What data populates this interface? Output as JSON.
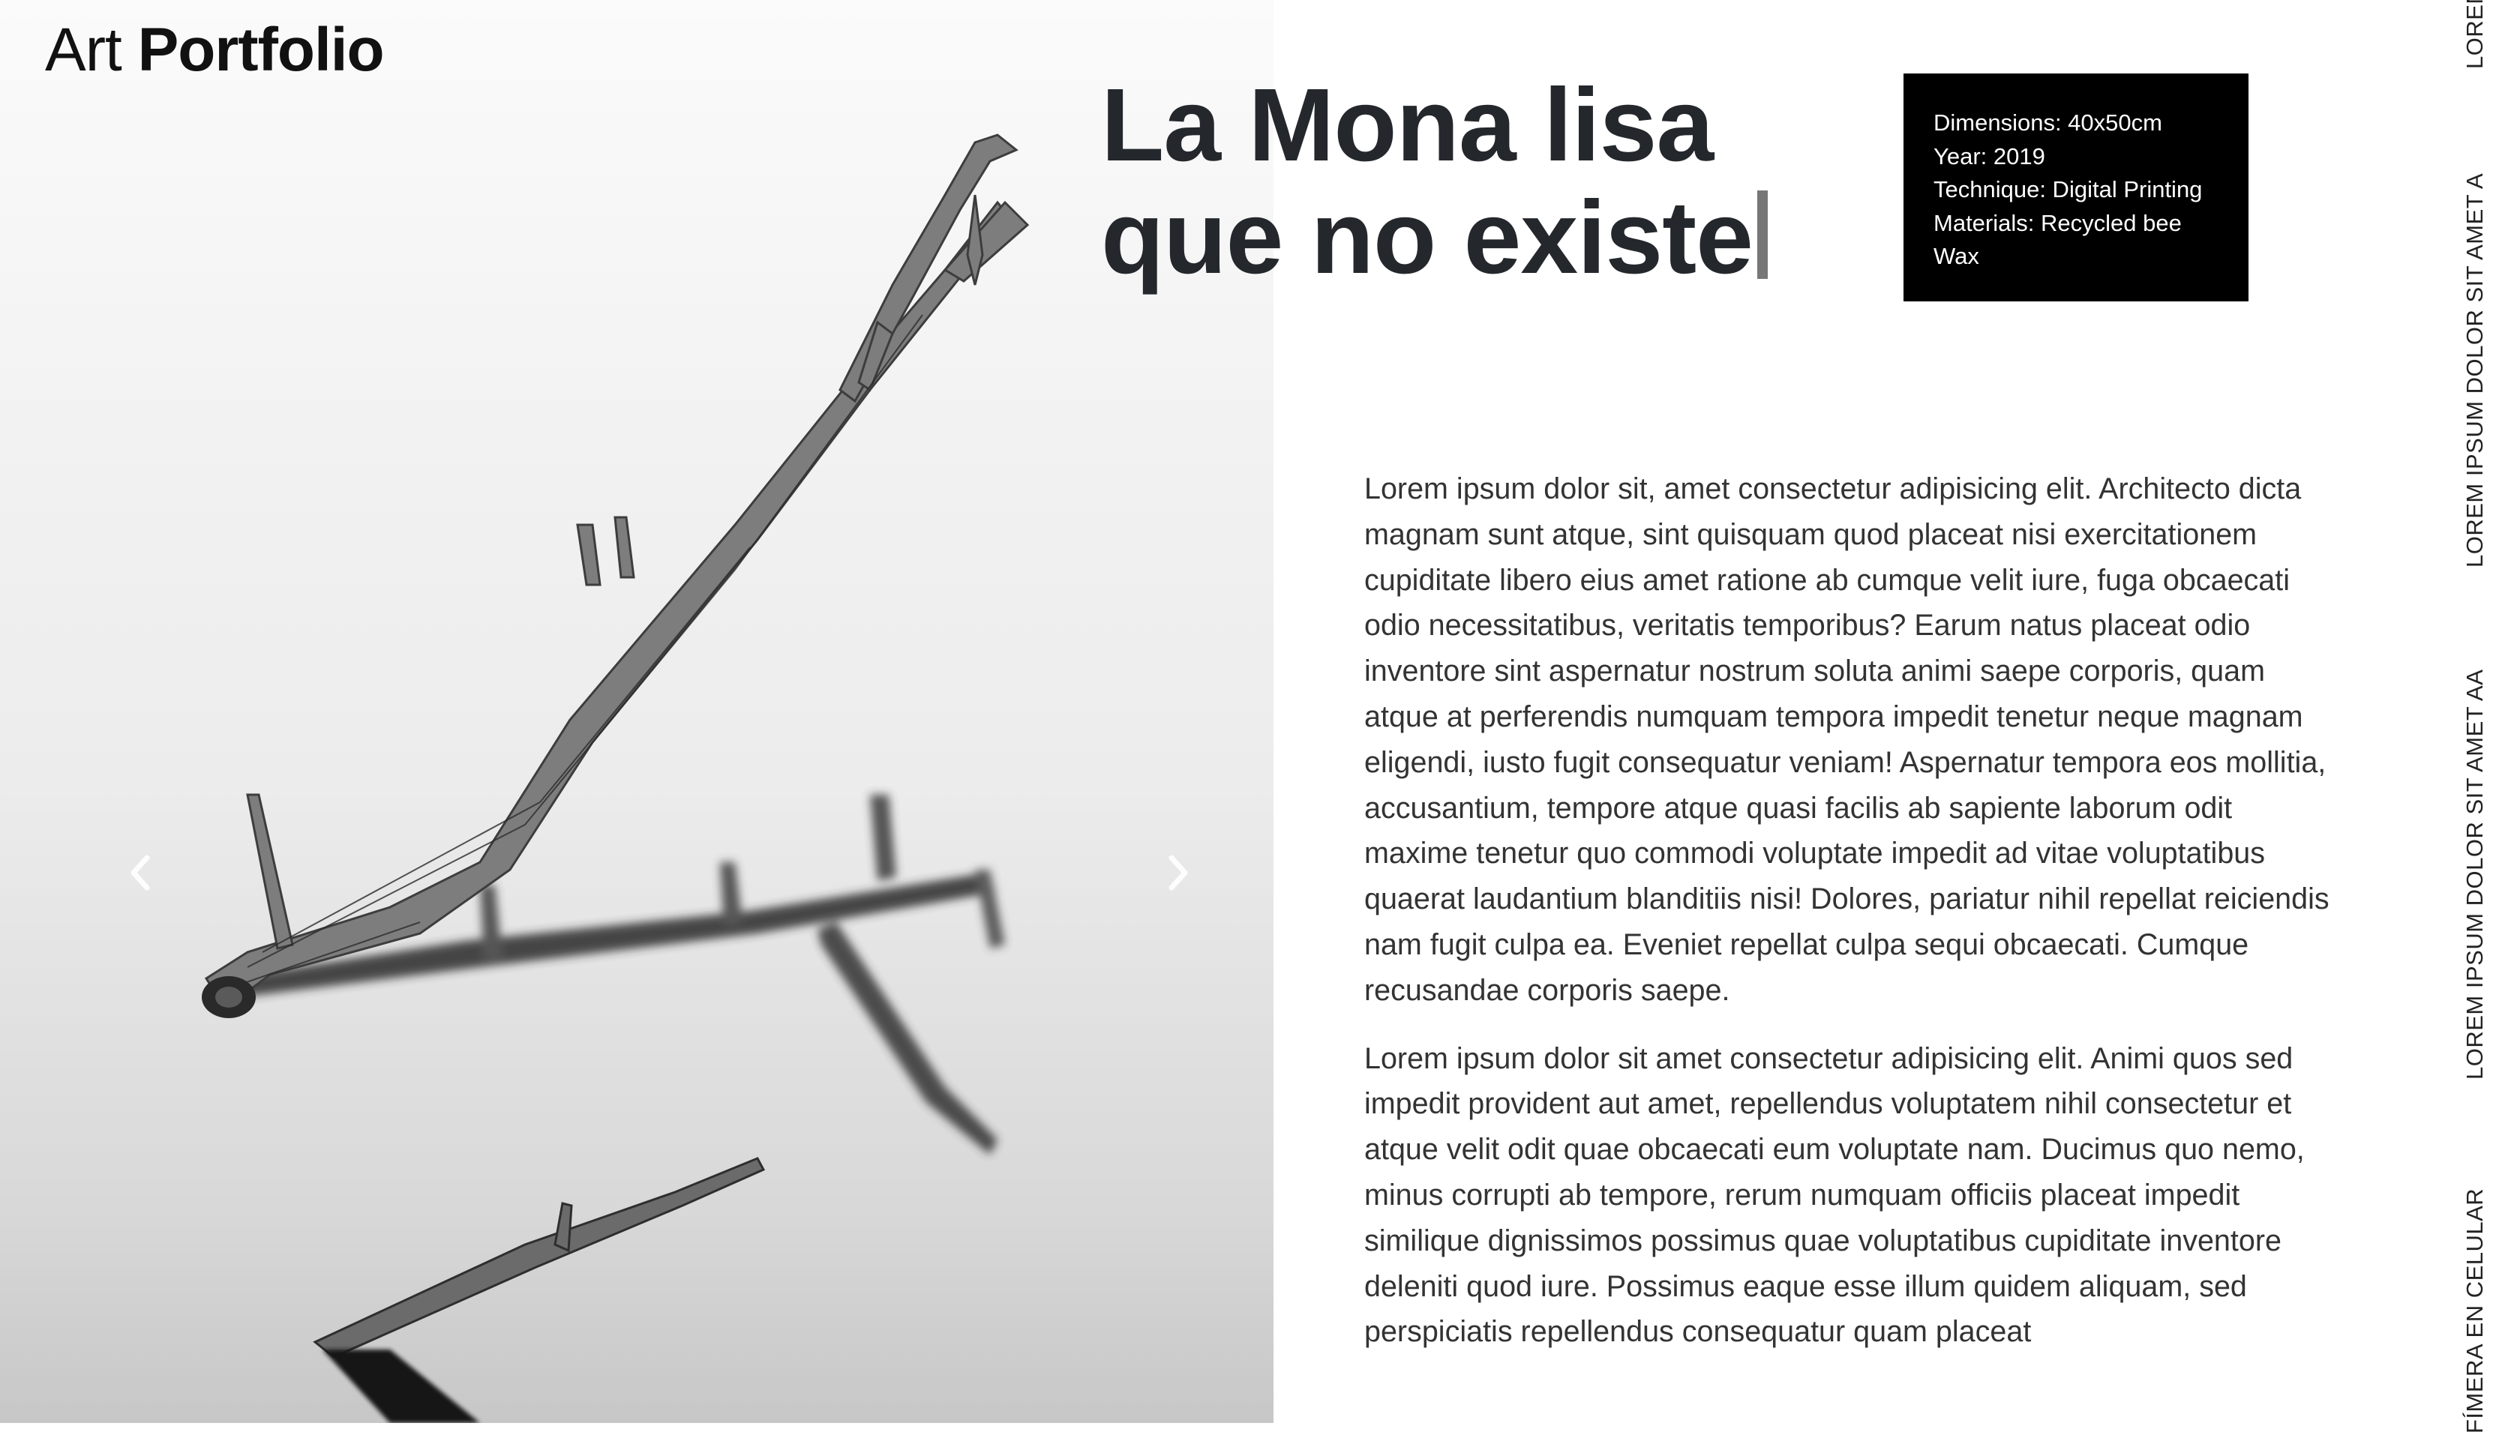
{
  "brand": {
    "light": "Art",
    "bold": "Portfolio"
  },
  "hero": {
    "prev_icon": "chevron-left-icon",
    "next_icon": "chevron-right-icon"
  },
  "artwork": {
    "title": "La Mona lisa que no existe",
    "specs": [
      "Dimensions: 40x50cm",
      "Year: 2019",
      "Technique: Digital Printing",
      "Materials: Recycled bee",
      "Wax"
    ],
    "paragraphs": [
      "Lorem ipsum dolor sit, amet consectetur adipisicing elit. Architecto dicta magnam sunt atque, sint quisquam quod placeat nisi exercitationem cupiditate libero eius amet ratione ab cumque velit iure, fuga obcaecati odio necessitatibus, veritatis temporibus? Earum natus placeat odio inventore sint aspernatur nostrum soluta animi saepe corporis, quam atque at perferendis numquam tempora impedit tenetur neque magnam eligendi, iusto fugit consequatur veniam! Aspernatur tempora eos mollitia, accusantium, tempore atque quasi facilis ab sapiente laborum odit maxime tenetur quo commodi voluptate impedit ad vitae voluptatibus quaerat laudantium blanditiis nisi! Dolores, pariatur nihil repellat reiciendis nam fugit culpa ea. Eveniet repellat culpa sequi obcaecati. Cumque recusandae corporis saepe.",
      "Lorem ipsum dolor sit amet consectetur adipisicing elit. Animi quos sed impedit provident aut amet, repellendus voluptatem nihil consectetur et atque velit odit quae obcaecati eum voluptate nam. Ducimus quo nemo, minus corrupti ab tempore, rerum numquam officiis placeat impedit similique dignissimos possimus quae voluptatibus cupiditate inventore deleniti quod iure. Possimus eaque esse illum quidem aliquam, sed perspiciatis repellendus consequatur quam placeat"
    ]
  },
  "side_nav": {
    "links": [
      "LOREM",
      "LOREM IPSUM DOLOR SIT AMET A",
      "LOREM IPSUM DOLOR SIT AMET AA",
      "FÍMERA EN CELULAR"
    ]
  }
}
